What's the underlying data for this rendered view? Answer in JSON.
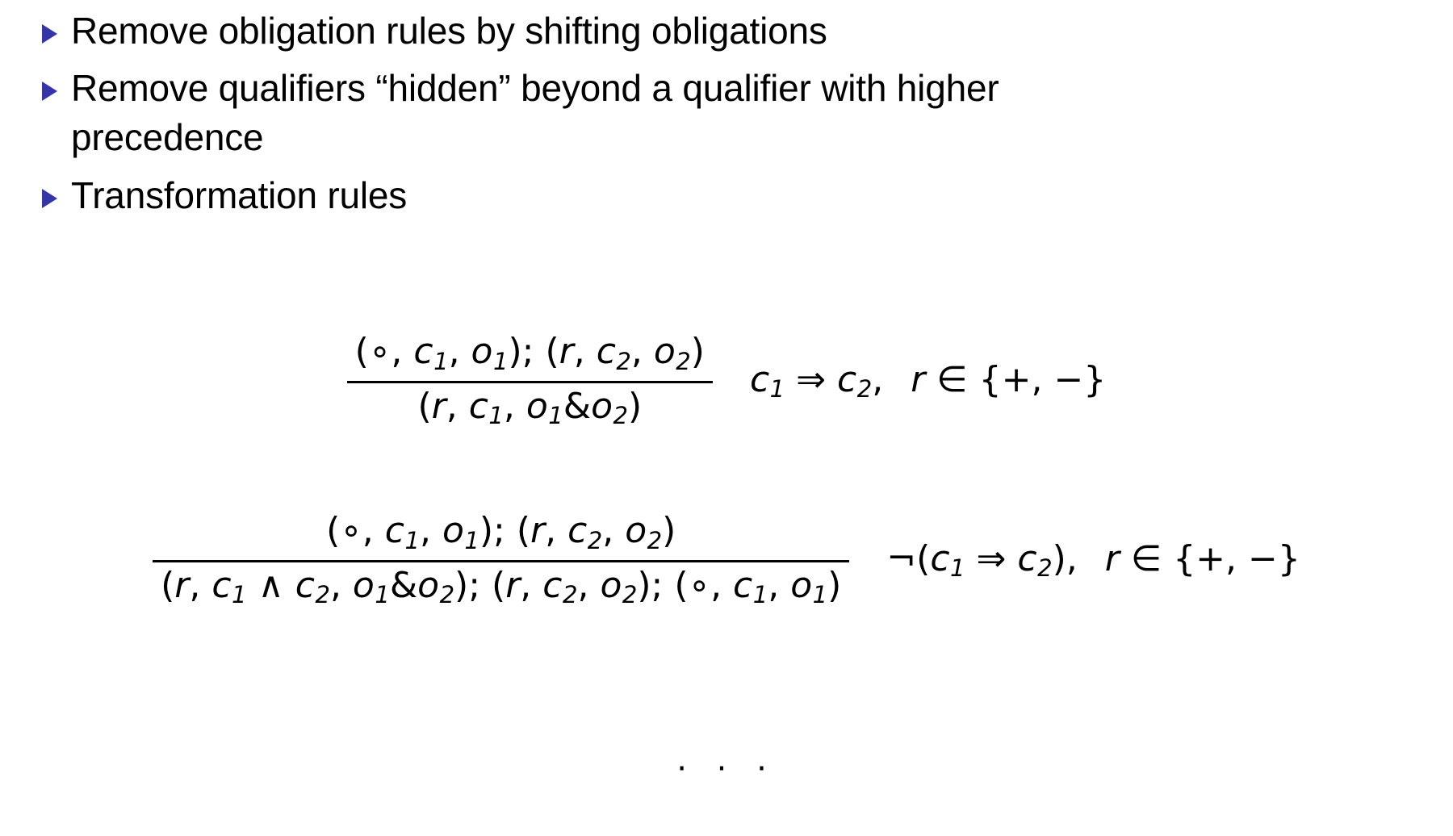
{
  "slide": {
    "bullets": [
      {
        "marker": "triangle-right-icon",
        "text": "Remove obligation rules by shifting obligations"
      },
      {
        "marker": "triangle-right-icon",
        "text": "Remove qualifiers “hidden” beyond a qualifier with higher precedence"
      },
      {
        "marker": "triangle-right-icon",
        "text": "Transformation rules"
      }
    ],
    "bullet_color": "#3535a8",
    "text_color": "#000000",
    "background_color": "#ffffff",
    "ellipsis": "· · ·",
    "rules": [
      {
        "id": "rule-1",
        "numerator": "(∘, c₁, o₁); (r, c₂, o₂)",
        "denominator": "(r, c₁, o₁&o₂)",
        "side_condition": "c₁ ⇒ c₂,    r ∈ {+, −}",
        "num_parts": {
          "p1_open": "(",
          "p1_circ": "∘",
          "p1_c": "c",
          "p1_c_sub": "1",
          "p1_o": "o",
          "p1_o_sub": "1",
          "p1_close": ")",
          "semi": ";",
          "p2_open": "(",
          "p2_r": "r",
          "p2_c": "c",
          "p2_c_sub": "2",
          "p2_o": "o",
          "p2_o_sub": "2",
          "p2_close": ")"
        },
        "den_parts": {
          "open": "(",
          "r": "r",
          "c": "c",
          "c_sub": "1",
          "o1": "o",
          "o1_sub": "1",
          "amp": "&",
          "o2": "o",
          "o2_sub": "2",
          "close": ")"
        },
        "cond_parts": {
          "c1": "c",
          "c1_sub": "1",
          "implies": "⇒",
          "c2": "c",
          "c2_sub": "2",
          "comma": ",",
          "r": "r",
          "in": "∈",
          "set": "{+, −}"
        }
      },
      {
        "id": "rule-2",
        "numerator": "(∘, c₁, o₁); (r, c₂, o₂)",
        "denominator": "(r, c₁ ∧ c₂, o₁&o₂); (r, c₂, o₂); (∘, c₁, o₁)",
        "side_condition": "¬(c₁ ⇒ c₂),    r ∈ {+, −}",
        "cond_parts": {
          "neg": "¬",
          "open": "(",
          "c1": "c",
          "c1_sub": "1",
          "implies": "⇒",
          "c2": "c",
          "c2_sub": "2",
          "close": ")",
          "comma": ",",
          "r": "r",
          "in": "∈",
          "set": "{+, −}"
        }
      }
    ]
  }
}
